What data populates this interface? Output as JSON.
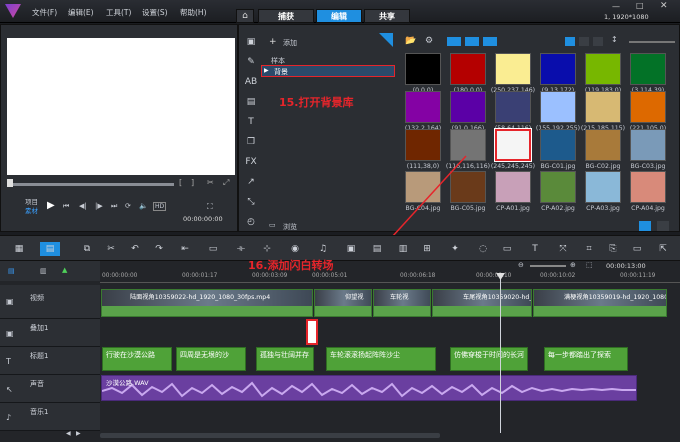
{
  "menu": [
    "文件(F)",
    "编辑(E)",
    "工具(T)",
    "设置(S)",
    "帮助(H)"
  ],
  "tabs": [
    "捕获",
    "编辑",
    "共享"
  ],
  "resolution": "1, 1920*1080",
  "preview": {
    "project_label": "项目",
    "clip_label": "素材",
    "timecode": "00:00:00:00"
  },
  "library": {
    "add_label": "添加",
    "folder_sample": "样本",
    "folder_background": "背景",
    "browse_label": "浏览",
    "annotation_15": "15.打开背景库",
    "swatches": [
      {
        "label": "(0,0,0)",
        "color": "#000000"
      },
      {
        "label": "(180,0,0)",
        "color": "#b40000"
      },
      {
        "label": "(250,237,146)",
        "color": "#faed92"
      },
      {
        "label": "(9,13,172)",
        "color": "#090dac"
      },
      {
        "label": "(119,183,0)",
        "color": "#77b700"
      },
      {
        "label": "(3,114,39)",
        "color": "#037227"
      },
      {
        "label": "(132,2,164)",
        "color": "#8402a4"
      },
      {
        "label": "(91,0,166)",
        "color": "#5b00a6"
      },
      {
        "label": "(58,64,116)",
        "color": "#3a4074"
      },
      {
        "label": "(155,192,255)",
        "color": "#9bc0ff"
      },
      {
        "label": "(215,185,115)",
        "color": "#d7b973"
      },
      {
        "label": "(221,105,0)",
        "color": "#dd6900"
      },
      {
        "label": "(111,38,0)",
        "color": "#6f2600"
      },
      {
        "label": "(116,116,116)",
        "color": "#747474"
      },
      {
        "label": "(245,245,245)",
        "color": "#f5f5f5"
      },
      {
        "label": "BG-C01.jpg",
        "color": "#1d5a8c"
      },
      {
        "label": "BG-C02.jpg",
        "color": "#a87a3a"
      },
      {
        "label": "BG-C03.jpg",
        "color": "#7a9ab8"
      },
      {
        "label": "BG-C04.jpg",
        "color": "#b89a7a"
      },
      {
        "label": "BG-C05.jpg",
        "color": "#6a3a1a"
      },
      {
        "label": "CP-A01.jpg",
        "color": "#c8a0b8"
      },
      {
        "label": "CP-A02.jpg",
        "color": "#5a8a3a"
      },
      {
        "label": "CP-A03.jpg",
        "color": "#8ab8d8"
      },
      {
        "label": "CP-A04.jpg",
        "color": "#d88a7a"
      }
    ]
  },
  "timeline": {
    "annotation_16": "16.添加闪白转场",
    "ruler": [
      "00:00:00:00",
      "00:00:01:17",
      "00:00:03:09",
      "00:00:05:01",
      "00:00:06:18",
      "00:00:08:10",
      "00:00:10:02",
      "00:00:11:19"
    ],
    "zoom_time": "00:00:13:00",
    "tracks": [
      "视频",
      "叠加1",
      "标题1",
      "声音",
      "音乐1"
    ],
    "video_clips": [
      {
        "label": "陆面视角10359022-hd_1920_1080_30fps.mp4"
      },
      {
        "label": "仰望视"
      },
      {
        "label": "车轮视"
      },
      {
        "label": "车尾视角10359020-hd_1920_1080"
      },
      {
        "label": "满梗视角10359019-hd_1920_1080"
      }
    ],
    "title_clips": [
      "行驶在沙漠公路",
      "四周是无垠的沙",
      "孤独与壮阔并存",
      "车轮滚滚扬起阵阵沙尘",
      "仿佛穿梭于时间的长河",
      "每一步都踏出了探索"
    ],
    "audio_clip": "沙漠公路.WAV"
  }
}
